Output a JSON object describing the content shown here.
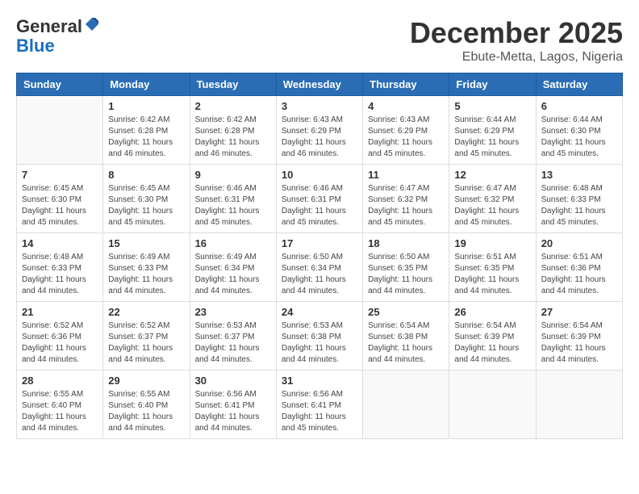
{
  "logo": {
    "general": "General",
    "blue": "Blue"
  },
  "title": "December 2025",
  "location": "Ebute-Metta, Lagos, Nigeria",
  "weekdays": [
    "Sunday",
    "Monday",
    "Tuesday",
    "Wednesday",
    "Thursday",
    "Friday",
    "Saturday"
  ],
  "weeks": [
    [
      {
        "day": "",
        "info": ""
      },
      {
        "day": "1",
        "info": "Sunrise: 6:42 AM\nSunset: 6:28 PM\nDaylight: 11 hours\nand 46 minutes."
      },
      {
        "day": "2",
        "info": "Sunrise: 6:42 AM\nSunset: 6:28 PM\nDaylight: 11 hours\nand 46 minutes."
      },
      {
        "day": "3",
        "info": "Sunrise: 6:43 AM\nSunset: 6:29 PM\nDaylight: 11 hours\nand 46 minutes."
      },
      {
        "day": "4",
        "info": "Sunrise: 6:43 AM\nSunset: 6:29 PM\nDaylight: 11 hours\nand 45 minutes."
      },
      {
        "day": "5",
        "info": "Sunrise: 6:44 AM\nSunset: 6:29 PM\nDaylight: 11 hours\nand 45 minutes."
      },
      {
        "day": "6",
        "info": "Sunrise: 6:44 AM\nSunset: 6:30 PM\nDaylight: 11 hours\nand 45 minutes."
      }
    ],
    [
      {
        "day": "7",
        "info": "Sunrise: 6:45 AM\nSunset: 6:30 PM\nDaylight: 11 hours\nand 45 minutes."
      },
      {
        "day": "8",
        "info": "Sunrise: 6:45 AM\nSunset: 6:30 PM\nDaylight: 11 hours\nand 45 minutes."
      },
      {
        "day": "9",
        "info": "Sunrise: 6:46 AM\nSunset: 6:31 PM\nDaylight: 11 hours\nand 45 minutes."
      },
      {
        "day": "10",
        "info": "Sunrise: 6:46 AM\nSunset: 6:31 PM\nDaylight: 11 hours\nand 45 minutes."
      },
      {
        "day": "11",
        "info": "Sunrise: 6:47 AM\nSunset: 6:32 PM\nDaylight: 11 hours\nand 45 minutes."
      },
      {
        "day": "12",
        "info": "Sunrise: 6:47 AM\nSunset: 6:32 PM\nDaylight: 11 hours\nand 45 minutes."
      },
      {
        "day": "13",
        "info": "Sunrise: 6:48 AM\nSunset: 6:33 PM\nDaylight: 11 hours\nand 45 minutes."
      }
    ],
    [
      {
        "day": "14",
        "info": "Sunrise: 6:48 AM\nSunset: 6:33 PM\nDaylight: 11 hours\nand 44 minutes."
      },
      {
        "day": "15",
        "info": "Sunrise: 6:49 AM\nSunset: 6:33 PM\nDaylight: 11 hours\nand 44 minutes."
      },
      {
        "day": "16",
        "info": "Sunrise: 6:49 AM\nSunset: 6:34 PM\nDaylight: 11 hours\nand 44 minutes."
      },
      {
        "day": "17",
        "info": "Sunrise: 6:50 AM\nSunset: 6:34 PM\nDaylight: 11 hours\nand 44 minutes."
      },
      {
        "day": "18",
        "info": "Sunrise: 6:50 AM\nSunset: 6:35 PM\nDaylight: 11 hours\nand 44 minutes."
      },
      {
        "day": "19",
        "info": "Sunrise: 6:51 AM\nSunset: 6:35 PM\nDaylight: 11 hours\nand 44 minutes."
      },
      {
        "day": "20",
        "info": "Sunrise: 6:51 AM\nSunset: 6:36 PM\nDaylight: 11 hours\nand 44 minutes."
      }
    ],
    [
      {
        "day": "21",
        "info": "Sunrise: 6:52 AM\nSunset: 6:36 PM\nDaylight: 11 hours\nand 44 minutes."
      },
      {
        "day": "22",
        "info": "Sunrise: 6:52 AM\nSunset: 6:37 PM\nDaylight: 11 hours\nand 44 minutes."
      },
      {
        "day": "23",
        "info": "Sunrise: 6:53 AM\nSunset: 6:37 PM\nDaylight: 11 hours\nand 44 minutes."
      },
      {
        "day": "24",
        "info": "Sunrise: 6:53 AM\nSunset: 6:38 PM\nDaylight: 11 hours\nand 44 minutes."
      },
      {
        "day": "25",
        "info": "Sunrise: 6:54 AM\nSunset: 6:38 PM\nDaylight: 11 hours\nand 44 minutes."
      },
      {
        "day": "26",
        "info": "Sunrise: 6:54 AM\nSunset: 6:39 PM\nDaylight: 11 hours\nand 44 minutes."
      },
      {
        "day": "27",
        "info": "Sunrise: 6:54 AM\nSunset: 6:39 PM\nDaylight: 11 hours\nand 44 minutes."
      }
    ],
    [
      {
        "day": "28",
        "info": "Sunrise: 6:55 AM\nSunset: 6:40 PM\nDaylight: 11 hours\nand 44 minutes."
      },
      {
        "day": "29",
        "info": "Sunrise: 6:55 AM\nSunset: 6:40 PM\nDaylight: 11 hours\nand 44 minutes."
      },
      {
        "day": "30",
        "info": "Sunrise: 6:56 AM\nSunset: 6:41 PM\nDaylight: 11 hours\nand 44 minutes."
      },
      {
        "day": "31",
        "info": "Sunrise: 6:56 AM\nSunset: 6:41 PM\nDaylight: 11 hours\nand 45 minutes."
      },
      {
        "day": "",
        "info": ""
      },
      {
        "day": "",
        "info": ""
      },
      {
        "day": "",
        "info": ""
      }
    ]
  ]
}
